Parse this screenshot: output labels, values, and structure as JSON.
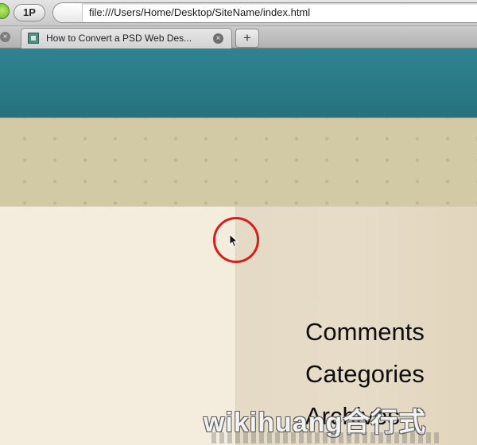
{
  "browser": {
    "personal_button_label": "1P",
    "address_url": "file:///Users/Home/Desktop/SiteName/index.html",
    "tabs": [
      {
        "title": "How to Convert a PSD Web Des...",
        "close_glyph": "×"
      }
    ],
    "left_close_glyph": "×",
    "new_tab_label": "+"
  },
  "page": {
    "colors": {
      "header": "#2a7883",
      "band": "#d2c9a5",
      "content": "#f4ecdd",
      "sidebar": "#e4dac5"
    },
    "sidebar_links": [
      "Comments",
      "Categories",
      "Archives"
    ]
  },
  "overlay": {
    "highlight_color": "#dd1c1c",
    "watermark_text": "wikihuang合行式"
  }
}
